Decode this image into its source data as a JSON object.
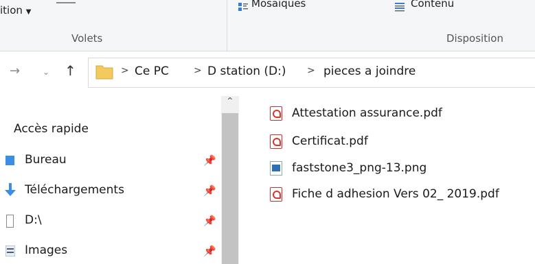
{
  "ribbon": {
    "partial_label": "ition",
    "volets_label": "Volets",
    "mosaiques_label": "Mosaïques",
    "contenu_label": "Contenu",
    "disposition_label": "Disposition"
  },
  "address": {
    "crumbs": [
      "Ce PC",
      "D station (D:)",
      "pieces a joindre"
    ],
    "separator": ">"
  },
  "nav_pane": {
    "header": "Accès rapide",
    "items": [
      {
        "label": "Bureau",
        "icon": "desktop-icon"
      },
      {
        "label": "Téléchargements",
        "icon": "download-icon"
      },
      {
        "label": "D:\\",
        "icon": "document-icon"
      },
      {
        "label": "Images",
        "icon": "images-icon"
      }
    ]
  },
  "files": [
    {
      "name": "Attestation assurance.pdf",
      "type": "pdf"
    },
    {
      "name": "Certificat.pdf",
      "type": "pdf"
    },
    {
      "name": "faststone3_png-13.png",
      "type": "png"
    },
    {
      "name": "Fiche d adhesion Vers  02_ 2019.pdf",
      "type": "pdf"
    }
  ],
  "colors": {
    "folder": "#f4c95d",
    "pdf_red": "#d9342b",
    "ribbon_bg": "#f5f6f7"
  }
}
